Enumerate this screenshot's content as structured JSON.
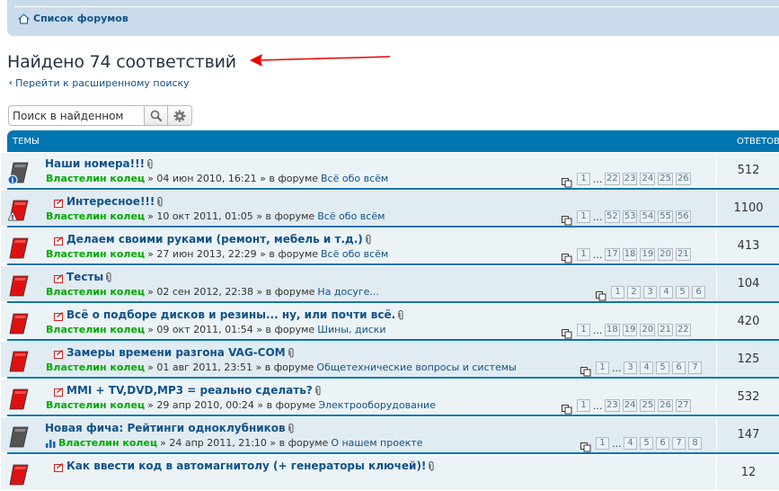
{
  "nav": {
    "forum_list": "Список форумов"
  },
  "page": {
    "title": "Найдено 74 соответствий",
    "advanced_search": "Перейти к расширенному поиску"
  },
  "search": {
    "placeholder": "Поиск в найденном"
  },
  "table": {
    "col_topics": "Темы",
    "col_replies": "Ответов"
  },
  "rows": [
    {
      "title": "Наши номера!!!",
      "author": "Властелин колец",
      "date": "» 04 июн 2010, 16:21 » в форуме",
      "forum": "Всё обо всём",
      "pages": [
        "1",
        "...",
        "22",
        "23",
        "24",
        "25",
        "26"
      ],
      "replies": "512"
    },
    {
      "title": "Интересное!!!",
      "author": "Властелин колец",
      "date": "» 10 окт 2011, 01:05 » в форуме",
      "forum": "Всё обо всём",
      "pages": [
        "1",
        "...",
        "52",
        "53",
        "54",
        "55",
        "56"
      ],
      "replies": "1100"
    },
    {
      "title": "Делаем своими руками (ремонт, мебель и т.д.)",
      "author": "Властелин колец",
      "date": "» 27 июн 2013, 22:29 » в форуме",
      "forum": "Всё обо всём",
      "pages": [
        "1",
        "...",
        "17",
        "18",
        "19",
        "20",
        "21"
      ],
      "replies": "413"
    },
    {
      "title": "Тесты",
      "author": "Властелин колец",
      "date": "» 02 сен 2012, 22:38 » в форуме",
      "forum": "На досуге...",
      "pages": [
        "1",
        "2",
        "3",
        "4",
        "5",
        "6"
      ],
      "replies": "104"
    },
    {
      "title": "Всё о подборе дисков и резины... ну, или почти всё.",
      "author": "Властелин колец",
      "date": "» 09 окт 2011, 01:54 » в форуме",
      "forum": "Шины, диски",
      "pages": [
        "1",
        "...",
        "18",
        "19",
        "20",
        "21",
        "22"
      ],
      "replies": "420"
    },
    {
      "title": "Замеры времени разгона VAG-COM",
      "author": "Властелин колец",
      "date": "» 01 авг 2011, 23:51 » в форуме",
      "forum": "Общетехнические вопросы и системы",
      "pages": [
        "1",
        "...",
        "3",
        "4",
        "5",
        "6",
        "7"
      ],
      "replies": "125"
    },
    {
      "title": "MMI + TV,DVD,MP3 = реально сделать?",
      "author": "Властелин колец",
      "date": "» 29 апр 2010, 00:24 » в форуме",
      "forum": "Электрооборудование",
      "pages": [
        "1",
        "...",
        "23",
        "24",
        "25",
        "26",
        "27"
      ],
      "replies": "532"
    },
    {
      "title": "Новая фича: Рейтинги одноклубников",
      "author": "Властелин колец",
      "date": "» 24 апр 2011, 21:10 » в форуме",
      "forum": "О нашем проекте",
      "pages": [
        "1",
        "...",
        "4",
        "5",
        "6",
        "7",
        "8"
      ],
      "replies": "147"
    },
    {
      "title": "Как ввести код в автомагнитолу (+ генераторы ключей)!",
      "author": "",
      "date": "",
      "forum": "",
      "pages": [],
      "replies": "12"
    }
  ],
  "colors": {
    "accent": "#0076b1",
    "link": "#105289",
    "author": "#00aa00",
    "row": "#ecf3f7",
    "row_alt": "#e1ebf2"
  }
}
